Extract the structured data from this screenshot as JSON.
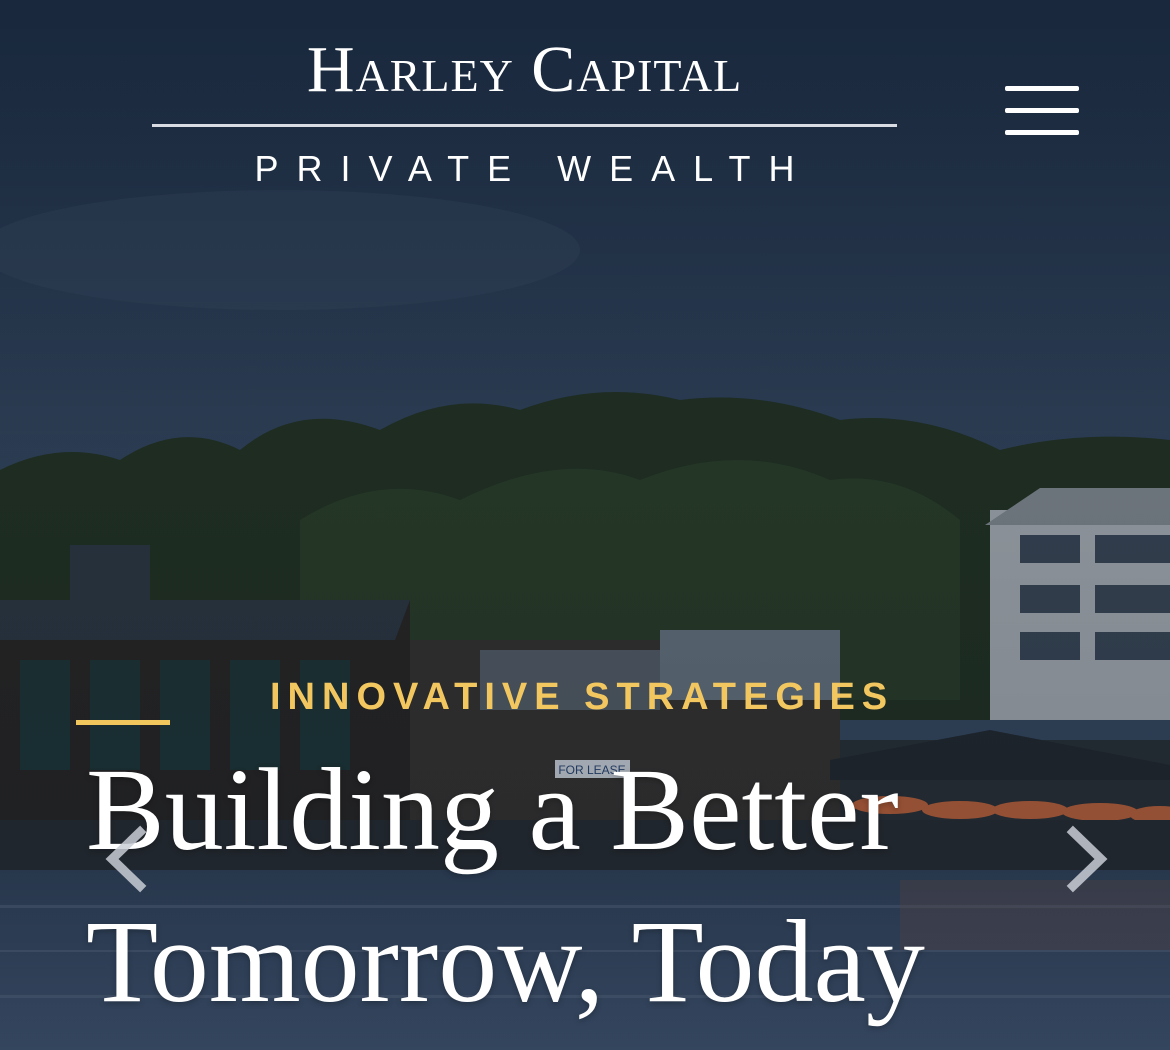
{
  "header": {
    "logo_title": "Harley Capital",
    "logo_subtitle": "PRIVATE WEALTH"
  },
  "hero": {
    "eyebrow": "INNOVATIVE STRATEGIES",
    "title_line1": "Building a Better",
    "title_line2": "Tomorrow, Today",
    "sign_text": "FOR LEASE"
  },
  "icons": {
    "menu": "hamburger-menu-icon",
    "prev": "chevron-left-icon",
    "next": "chevron-right-icon"
  },
  "colors": {
    "accent": "#f3c760",
    "text": "#ffffff",
    "sky": "#2a3c55"
  }
}
